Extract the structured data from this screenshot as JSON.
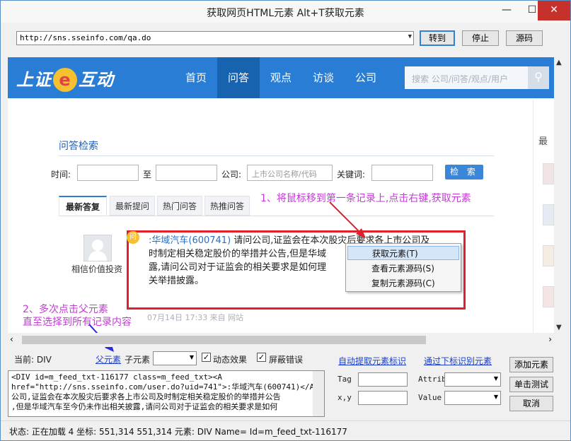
{
  "window": {
    "title": "获取网页HTML元素 Alt+T获取元素",
    "minimize": "—",
    "maximize": "☐",
    "close": "✕"
  },
  "toolbar": {
    "url": "http://sns.sseinfo.com/qa.do",
    "go_label": "转到",
    "stop_label": "停止",
    "source_label": "源码"
  },
  "site": {
    "logo_text_1": "上证",
    "logo_e": "e",
    "logo_text_2": "互动",
    "nav": [
      "首页",
      "问答",
      "观点",
      "访谈",
      "公司"
    ],
    "active_nav": 1,
    "search_placeholder": "搜索 公司/问答/观点/用户",
    "side_label": "最"
  },
  "search_form": {
    "title": "问答检索",
    "time_label": "时间:",
    "to_label": "至",
    "company_label": "公司:",
    "company_placeholder": "上市公司名称/代码",
    "keyword_label": "关键词:",
    "search_button": "检 索"
  },
  "tabs": [
    "最新答复",
    "最新提问",
    "热门问答",
    "热推问答"
  ],
  "feed": {
    "username": "相信价值投资",
    "company_link": ":华域汽车(600741)",
    "question": "请问公司,证监会在本次股灾后要求各上市公司及时制定相关稳定股价的举措并公告,但是华域汽车至今仍未作出相关披露,请问公司对于证监会的相关要求是如何理解的?请及时作出相关举措披露。",
    "question_lines": [
      "请问公司,证监会在本次股灾后要求各上市公司及",
      "时制定相关稳定股价的举措并公告,但是华域",
      "露,请问公司对于证监会的相关要求是如何理",
      "关举措披露。"
    ],
    "meta": "07月14日 17:33 来自 网站"
  },
  "annotations": {
    "step1": "1、将鼠标移到第一条记录上,点击右键,获取元素",
    "step2_line1": "2、多次点击父元素",
    "step2_line2": "直至选择到所有记录内容"
  },
  "context_menu": [
    "获取元素(T)",
    "查看元素源码(S)",
    "复制元素源码(C)"
  ],
  "inspector": {
    "current_label": "当前: DIV",
    "parent_link": "父元素",
    "child_label": "子元素",
    "dynamic_label": "动态效果",
    "dynamic_checked": true,
    "block_errors_label": "屏蔽错误",
    "block_errors_checked": true,
    "auto_extract_link": "自动提取元素标识",
    "recognize_link": "通过下标识别元素",
    "add_element_button": "添加元素",
    "test_button": "单击测试",
    "cancel_button": "取消",
    "tag_label": "Tag",
    "xy_label": "x,y",
    "attrib_label": "Attrib",
    "value_label": "Value",
    "code_lines": [
      "<DIV id=m_feed_txt-116177 class=m_feed_txt><A",
      "href=\"http://sns.sseinfo.com/user.do?uid=741\">:华域汽车(600741)</A>请问",
      "公司,证监会在本次股灾后要求各上市公司及时制定相关稳定股价的举措并公告",
      ",但是华域汽车至今仍未作出相关披露,请问公司对于证监会的相关要求是如何"
    ]
  },
  "status": {
    "text": "状态: 正在加载 4 坐标: 551,314 551,314 元素: DIV Name= Id=m_feed_txt-116177"
  },
  "colors": {
    "accent": "#2a7dd5",
    "annotation": "#c43ad7",
    "highlight_box": "#e0202a"
  }
}
